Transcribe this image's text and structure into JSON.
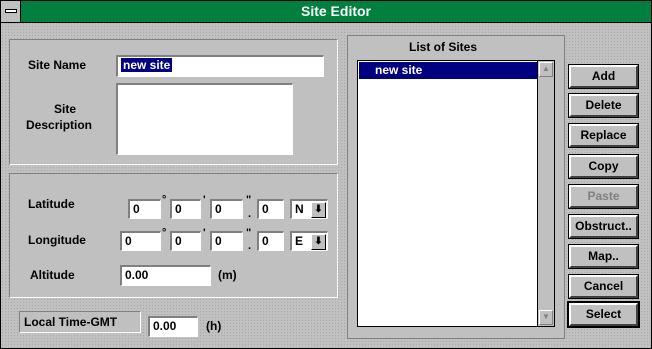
{
  "window": {
    "title": "Site Editor"
  },
  "site": {
    "name_label": "Site Name",
    "name_value": "new site",
    "desc_label_line1": "Site",
    "desc_label_line2": "Description",
    "desc_value": ""
  },
  "coords": {
    "latitude_label": "Latitude",
    "latitude": {
      "deg": "0",
      "min": "0",
      "sec": "0",
      "frac": "0",
      "dir": "N"
    },
    "longitude_label": "Longitude",
    "longitude": {
      "deg": "0",
      "min": "0",
      "sec": "0",
      "frac": "0",
      "dir": "E"
    },
    "altitude_label": "Altitude",
    "altitude_value": "0.00",
    "altitude_unit": "(m)",
    "degree_symbol": "°",
    "minute_symbol": "'",
    "second_symbol": "\"",
    "decimal_symbol": ".",
    "dropdown_glyph": "⬇"
  },
  "time": {
    "label": "Local Time-GMT",
    "value": "0.00",
    "unit": "(h)"
  },
  "list": {
    "header": "List of Sites",
    "items": [
      "new site"
    ],
    "scroll_up_glyph": "▲",
    "scroll_down_glyph": "▼"
  },
  "buttons": {
    "add": "Add",
    "delete": "Delete",
    "replace": "Replace",
    "copy": "Copy",
    "paste": "Paste",
    "obstruct": "Obstruct..",
    "map": "Map..",
    "cancel": "Cancel",
    "select": "Select"
  }
}
